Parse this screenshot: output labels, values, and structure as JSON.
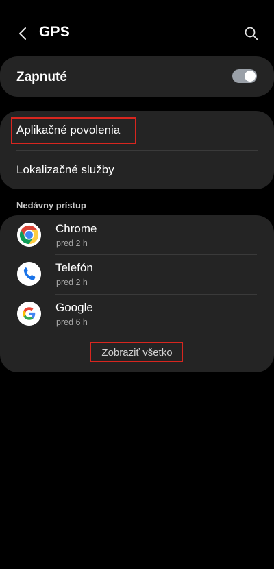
{
  "header": {
    "title": "GPS",
    "back_icon": "chevron-left-icon",
    "search_icon": "search-icon"
  },
  "toggle": {
    "label": "Zapnuté",
    "state": "on"
  },
  "menu": {
    "items": [
      {
        "label": "Aplikačné povolenia",
        "highlighted": true
      },
      {
        "label": "Lokalizačné služby",
        "highlighted": false
      }
    ]
  },
  "recent": {
    "section_label": "Nedávny prístup",
    "apps": [
      {
        "name": "Chrome",
        "time": "pred 2 h",
        "icon": "chrome-icon"
      },
      {
        "name": "Telefón",
        "time": "pred 2 h",
        "icon": "phone-icon"
      },
      {
        "name": "Google",
        "time": "pred 6 h",
        "icon": "google-icon"
      }
    ],
    "see_all_label": "Zobraziť všetko"
  },
  "colors": {
    "background": "#000000",
    "card": "#242424",
    "highlight": "#d8261f",
    "switch": "#9aa0a8"
  }
}
